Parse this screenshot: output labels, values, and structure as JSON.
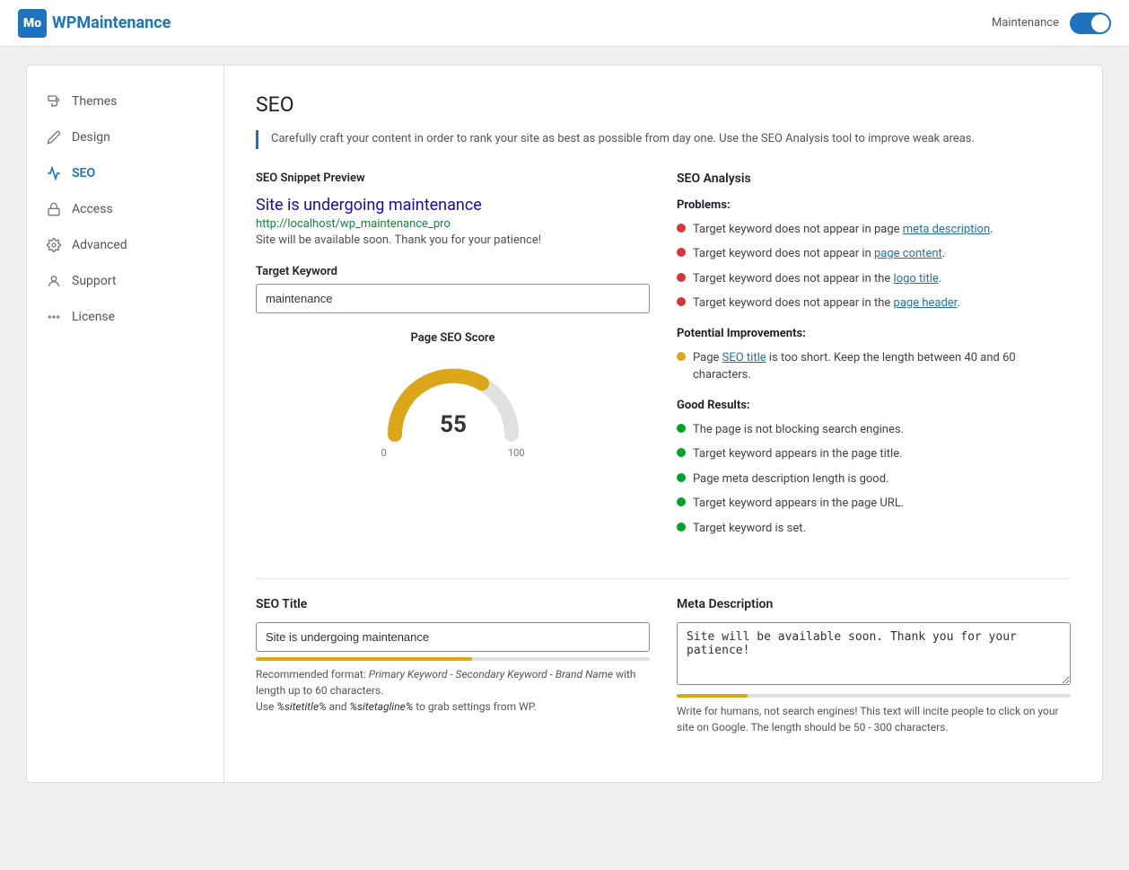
{
  "header": {
    "logo_icon": "Mo",
    "logo_prefix": "WP",
    "logo_suffix": "Maintenance",
    "maintenance_label": "Maintenance",
    "toggle_state": true
  },
  "sidebar": {
    "items": [
      {
        "id": "themes",
        "label": "Themes",
        "icon": "paint-roller",
        "active": false
      },
      {
        "id": "design",
        "label": "Design",
        "icon": "pencil",
        "active": false
      },
      {
        "id": "seo",
        "label": "SEO",
        "icon": "chart-line",
        "active": true
      },
      {
        "id": "access",
        "label": "Access",
        "icon": "lock",
        "active": false
      },
      {
        "id": "advanced",
        "label": "Advanced",
        "icon": "gear",
        "active": false
      },
      {
        "id": "support",
        "label": "Support",
        "icon": "person-circle",
        "active": false
      },
      {
        "id": "license",
        "label": "License",
        "icon": "dots",
        "active": false
      }
    ]
  },
  "page": {
    "title": "SEO",
    "description": "Carefully craft your content in order to rank your site as best as possible from day one. Use the SEO Analysis tool to improve weak areas."
  },
  "seo_snippet": {
    "section_label": "SEO Snippet Preview",
    "snippet_title": "Site is undergoing maintenance",
    "snippet_url": "http://localhost/wp_maintenance_pro",
    "snippet_desc": "Site will be available soon. Thank you for your patience!"
  },
  "target_keyword": {
    "label": "Target Keyword",
    "value": "maintenance",
    "placeholder": "maintenance"
  },
  "page_score": {
    "label": "Page SEO Score",
    "score": 55,
    "min": 0,
    "max": 100
  },
  "seo_analysis": {
    "title": "SEO Analysis",
    "problems_label": "Problems:",
    "problems": [
      {
        "text": "Target keyword does not appear in page ",
        "link_text": "meta description",
        "link_id": "meta-description",
        "suffix": "."
      },
      {
        "text": "Target keyword does not appear in ",
        "link_text": "page content",
        "link_id": "page-content",
        "suffix": "."
      },
      {
        "text": "Target keyword does not appear in the ",
        "link_text": "logo title",
        "link_id": "logo-title",
        "suffix": "."
      },
      {
        "text": "Target keyword does not appear in the ",
        "link_text": "page header",
        "link_id": "page-header",
        "suffix": "."
      }
    ],
    "improvements_label": "Potential Improvements:",
    "improvements": [
      {
        "text": "Page ",
        "link_text": "SEO title",
        "link_id": "seo-title",
        "suffix": " is too short. Keep the length between 40 and 60 characters."
      }
    ],
    "good_label": "Good Results:",
    "good": [
      "The page is not blocking search engines.",
      "Target keyword appears in the page title.",
      "Page meta description length is good.",
      "Target keyword appears in the page URL.",
      "Target keyword is set."
    ]
  },
  "seo_title": {
    "label": "SEO Title",
    "value": "Site is undergoing maintenance",
    "progress_width": "55%",
    "hint_line1_prefix": "Recommended format: ",
    "hint_line1_italic": "Primary Keyword - Secondary Keyword - Brand Name",
    "hint_line1_suffix": " with length up to 60 characters.",
    "hint_line2_prefix": "Use ",
    "hint_code1": "%sitetitle%",
    "hint_line2_middle": " and ",
    "hint_code2": "%sitetagline%",
    "hint_line2_suffix": " to grab settings from WP."
  },
  "meta_description": {
    "label": "Meta Description",
    "value": "Site will be available soon. Thank you for your patience!",
    "progress_width": "18%",
    "hint": "Write for humans, not search engines! This text will incite people to click on your site on Google. The length should be 50 - 300 characters."
  }
}
